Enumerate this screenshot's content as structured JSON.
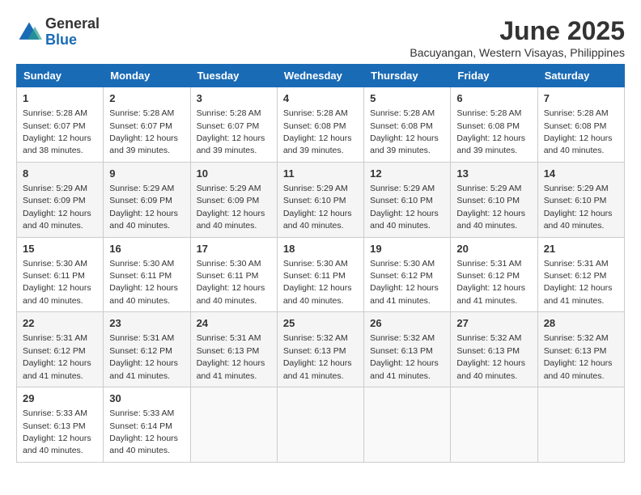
{
  "header": {
    "logo_general": "General",
    "logo_blue": "Blue",
    "month_year": "June 2025",
    "location": "Bacuyangan, Western Visayas, Philippines"
  },
  "days_of_week": [
    "Sunday",
    "Monday",
    "Tuesday",
    "Wednesday",
    "Thursday",
    "Friday",
    "Saturday"
  ],
  "weeks": [
    [
      {
        "day": "1",
        "sunrise": "5:28 AM",
        "sunset": "6:07 PM",
        "daylight": "12 hours and 38 minutes."
      },
      {
        "day": "2",
        "sunrise": "5:28 AM",
        "sunset": "6:07 PM",
        "daylight": "12 hours and 39 minutes."
      },
      {
        "day": "3",
        "sunrise": "5:28 AM",
        "sunset": "6:07 PM",
        "daylight": "12 hours and 39 minutes."
      },
      {
        "day": "4",
        "sunrise": "5:28 AM",
        "sunset": "6:08 PM",
        "daylight": "12 hours and 39 minutes."
      },
      {
        "day": "5",
        "sunrise": "5:28 AM",
        "sunset": "6:08 PM",
        "daylight": "12 hours and 39 minutes."
      },
      {
        "day": "6",
        "sunrise": "5:28 AM",
        "sunset": "6:08 PM",
        "daylight": "12 hours and 39 minutes."
      },
      {
        "day": "7",
        "sunrise": "5:28 AM",
        "sunset": "6:08 PM",
        "daylight": "12 hours and 40 minutes."
      }
    ],
    [
      {
        "day": "8",
        "sunrise": "5:29 AM",
        "sunset": "6:09 PM",
        "daylight": "12 hours and 40 minutes."
      },
      {
        "day": "9",
        "sunrise": "5:29 AM",
        "sunset": "6:09 PM",
        "daylight": "12 hours and 40 minutes."
      },
      {
        "day": "10",
        "sunrise": "5:29 AM",
        "sunset": "6:09 PM",
        "daylight": "12 hours and 40 minutes."
      },
      {
        "day": "11",
        "sunrise": "5:29 AM",
        "sunset": "6:10 PM",
        "daylight": "12 hours and 40 minutes."
      },
      {
        "day": "12",
        "sunrise": "5:29 AM",
        "sunset": "6:10 PM",
        "daylight": "12 hours and 40 minutes."
      },
      {
        "day": "13",
        "sunrise": "5:29 AM",
        "sunset": "6:10 PM",
        "daylight": "12 hours and 40 minutes."
      },
      {
        "day": "14",
        "sunrise": "5:29 AM",
        "sunset": "6:10 PM",
        "daylight": "12 hours and 40 minutes."
      }
    ],
    [
      {
        "day": "15",
        "sunrise": "5:30 AM",
        "sunset": "6:11 PM",
        "daylight": "12 hours and 40 minutes."
      },
      {
        "day": "16",
        "sunrise": "5:30 AM",
        "sunset": "6:11 PM",
        "daylight": "12 hours and 40 minutes."
      },
      {
        "day": "17",
        "sunrise": "5:30 AM",
        "sunset": "6:11 PM",
        "daylight": "12 hours and 40 minutes."
      },
      {
        "day": "18",
        "sunrise": "5:30 AM",
        "sunset": "6:11 PM",
        "daylight": "12 hours and 40 minutes."
      },
      {
        "day": "19",
        "sunrise": "5:30 AM",
        "sunset": "6:12 PM",
        "daylight": "12 hours and 41 minutes."
      },
      {
        "day": "20",
        "sunrise": "5:31 AM",
        "sunset": "6:12 PM",
        "daylight": "12 hours and 41 minutes."
      },
      {
        "day": "21",
        "sunrise": "5:31 AM",
        "sunset": "6:12 PM",
        "daylight": "12 hours and 41 minutes."
      }
    ],
    [
      {
        "day": "22",
        "sunrise": "5:31 AM",
        "sunset": "6:12 PM",
        "daylight": "12 hours and 41 minutes."
      },
      {
        "day": "23",
        "sunrise": "5:31 AM",
        "sunset": "6:12 PM",
        "daylight": "12 hours and 41 minutes."
      },
      {
        "day": "24",
        "sunrise": "5:31 AM",
        "sunset": "6:13 PM",
        "daylight": "12 hours and 41 minutes."
      },
      {
        "day": "25",
        "sunrise": "5:32 AM",
        "sunset": "6:13 PM",
        "daylight": "12 hours and 41 minutes."
      },
      {
        "day": "26",
        "sunrise": "5:32 AM",
        "sunset": "6:13 PM",
        "daylight": "12 hours and 41 minutes."
      },
      {
        "day": "27",
        "sunrise": "5:32 AM",
        "sunset": "6:13 PM",
        "daylight": "12 hours and 40 minutes."
      },
      {
        "day": "28",
        "sunrise": "5:32 AM",
        "sunset": "6:13 PM",
        "daylight": "12 hours and 40 minutes."
      }
    ],
    [
      {
        "day": "29",
        "sunrise": "5:33 AM",
        "sunset": "6:13 PM",
        "daylight": "12 hours and 40 minutes."
      },
      {
        "day": "30",
        "sunrise": "5:33 AM",
        "sunset": "6:14 PM",
        "daylight": "12 hours and 40 minutes."
      },
      null,
      null,
      null,
      null,
      null
    ]
  ],
  "labels": {
    "sunrise": "Sunrise:",
    "sunset": "Sunset:",
    "daylight": "Daylight:"
  }
}
